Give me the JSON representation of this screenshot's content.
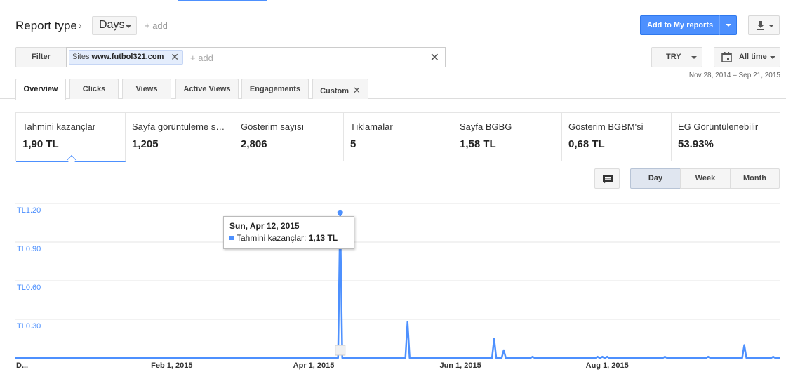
{
  "header": {
    "report_type_label": "Report type",
    "breadcrumb_sep": "›",
    "dimension_value": "Days",
    "add_label": "+ add",
    "add_to_reports": "Add to My reports"
  },
  "filter": {
    "button_label": "Filter",
    "chip_label": "Sites",
    "chip_value": "www.futbol321.com",
    "add_placeholder": "+ add",
    "clear_symbol": "✕"
  },
  "controls": {
    "currency": "TRY",
    "time_range": "All time",
    "date_range": "Nov 28, 2014 – Sep 21, 2015"
  },
  "tabs": [
    {
      "label": "Overview",
      "active": true
    },
    {
      "label": "Clicks",
      "active": false
    },
    {
      "label": "Views",
      "active": false
    },
    {
      "label": "Active Views",
      "active": false
    },
    {
      "label": "Engagements",
      "active": false
    },
    {
      "label": "Custom",
      "active": false,
      "closable": true
    }
  ],
  "metrics": [
    {
      "label": "Tahmini kazançlar",
      "value": "1,90 TL",
      "selected": true
    },
    {
      "label": "Sayfa görüntüleme sayısı",
      "display_label": "Sayfa görüntüleme s…",
      "value": "1,205"
    },
    {
      "label": "Gösterim sayısı",
      "value": "2,806"
    },
    {
      "label": "Tıklamalar",
      "value": "5"
    },
    {
      "label": "Sayfa BGBG",
      "value": "1,58 TL"
    },
    {
      "label": "Gösterim BGBM'si",
      "value": "0,68 TL"
    },
    {
      "label": "EG Görüntülenebilir",
      "value": "53.93%"
    }
  ],
  "granularity": {
    "options": [
      "Day",
      "Week",
      "Month"
    ],
    "selected": "Day"
  },
  "icons": {
    "chevron": "chevron-right-icon",
    "download": "download-icon",
    "calendar": "calendar-icon",
    "annotation": "comment-icon"
  },
  "colors": {
    "accent": "#4d90fe",
    "series": "#4d90fe"
  },
  "tooltip": {
    "date": "Sun, Apr 12, 2015",
    "series": "Tahmini kazançlar:",
    "value": "1,13 TL"
  },
  "chart_data": {
    "type": "line",
    "series": [
      {
        "name": "Tahmini kazançlar"
      }
    ],
    "x_range": [
      "2014-11-28",
      "2015-09-21"
    ],
    "ylim": [
      0,
      1.2
    ],
    "yticks": [
      "TL0.30",
      "TL0.60",
      "TL0.90",
      "TL1.20"
    ],
    "ytick_values": [
      0.3,
      0.6,
      0.9,
      1.2
    ],
    "xtick_labels": [
      "D...",
      "Feb 1, 2015",
      "Apr 1, 2015",
      "Jun 1, 2015",
      "Aug 1, 2015"
    ],
    "xtick_dates": [
      "2014-11-28",
      "2015-02-01",
      "2015-04-01",
      "2015-06-01",
      "2015-08-01"
    ],
    "points": [
      {
        "date": "2015-04-12",
        "value": 1.13
      },
      {
        "date": "2015-05-10",
        "value": 0.28
      },
      {
        "date": "2015-06-15",
        "value": 0.15
      },
      {
        "date": "2015-06-19",
        "value": 0.06
      },
      {
        "date": "2015-07-01",
        "value": 0.01
      },
      {
        "date": "2015-07-28",
        "value": 0.01
      },
      {
        "date": "2015-07-30",
        "value": 0.01
      },
      {
        "date": "2015-08-25",
        "value": 0.01
      },
      {
        "date": "2015-08-01",
        "value": 0.01
      },
      {
        "date": "2015-09-12",
        "value": 0.01
      },
      {
        "date": "2015-09-27",
        "value": 0.1
      },
      {
        "date": "2015-10-09",
        "value": 0.01
      }
    ],
    "grid": true,
    "highlight_date": "2015-04-12"
  }
}
